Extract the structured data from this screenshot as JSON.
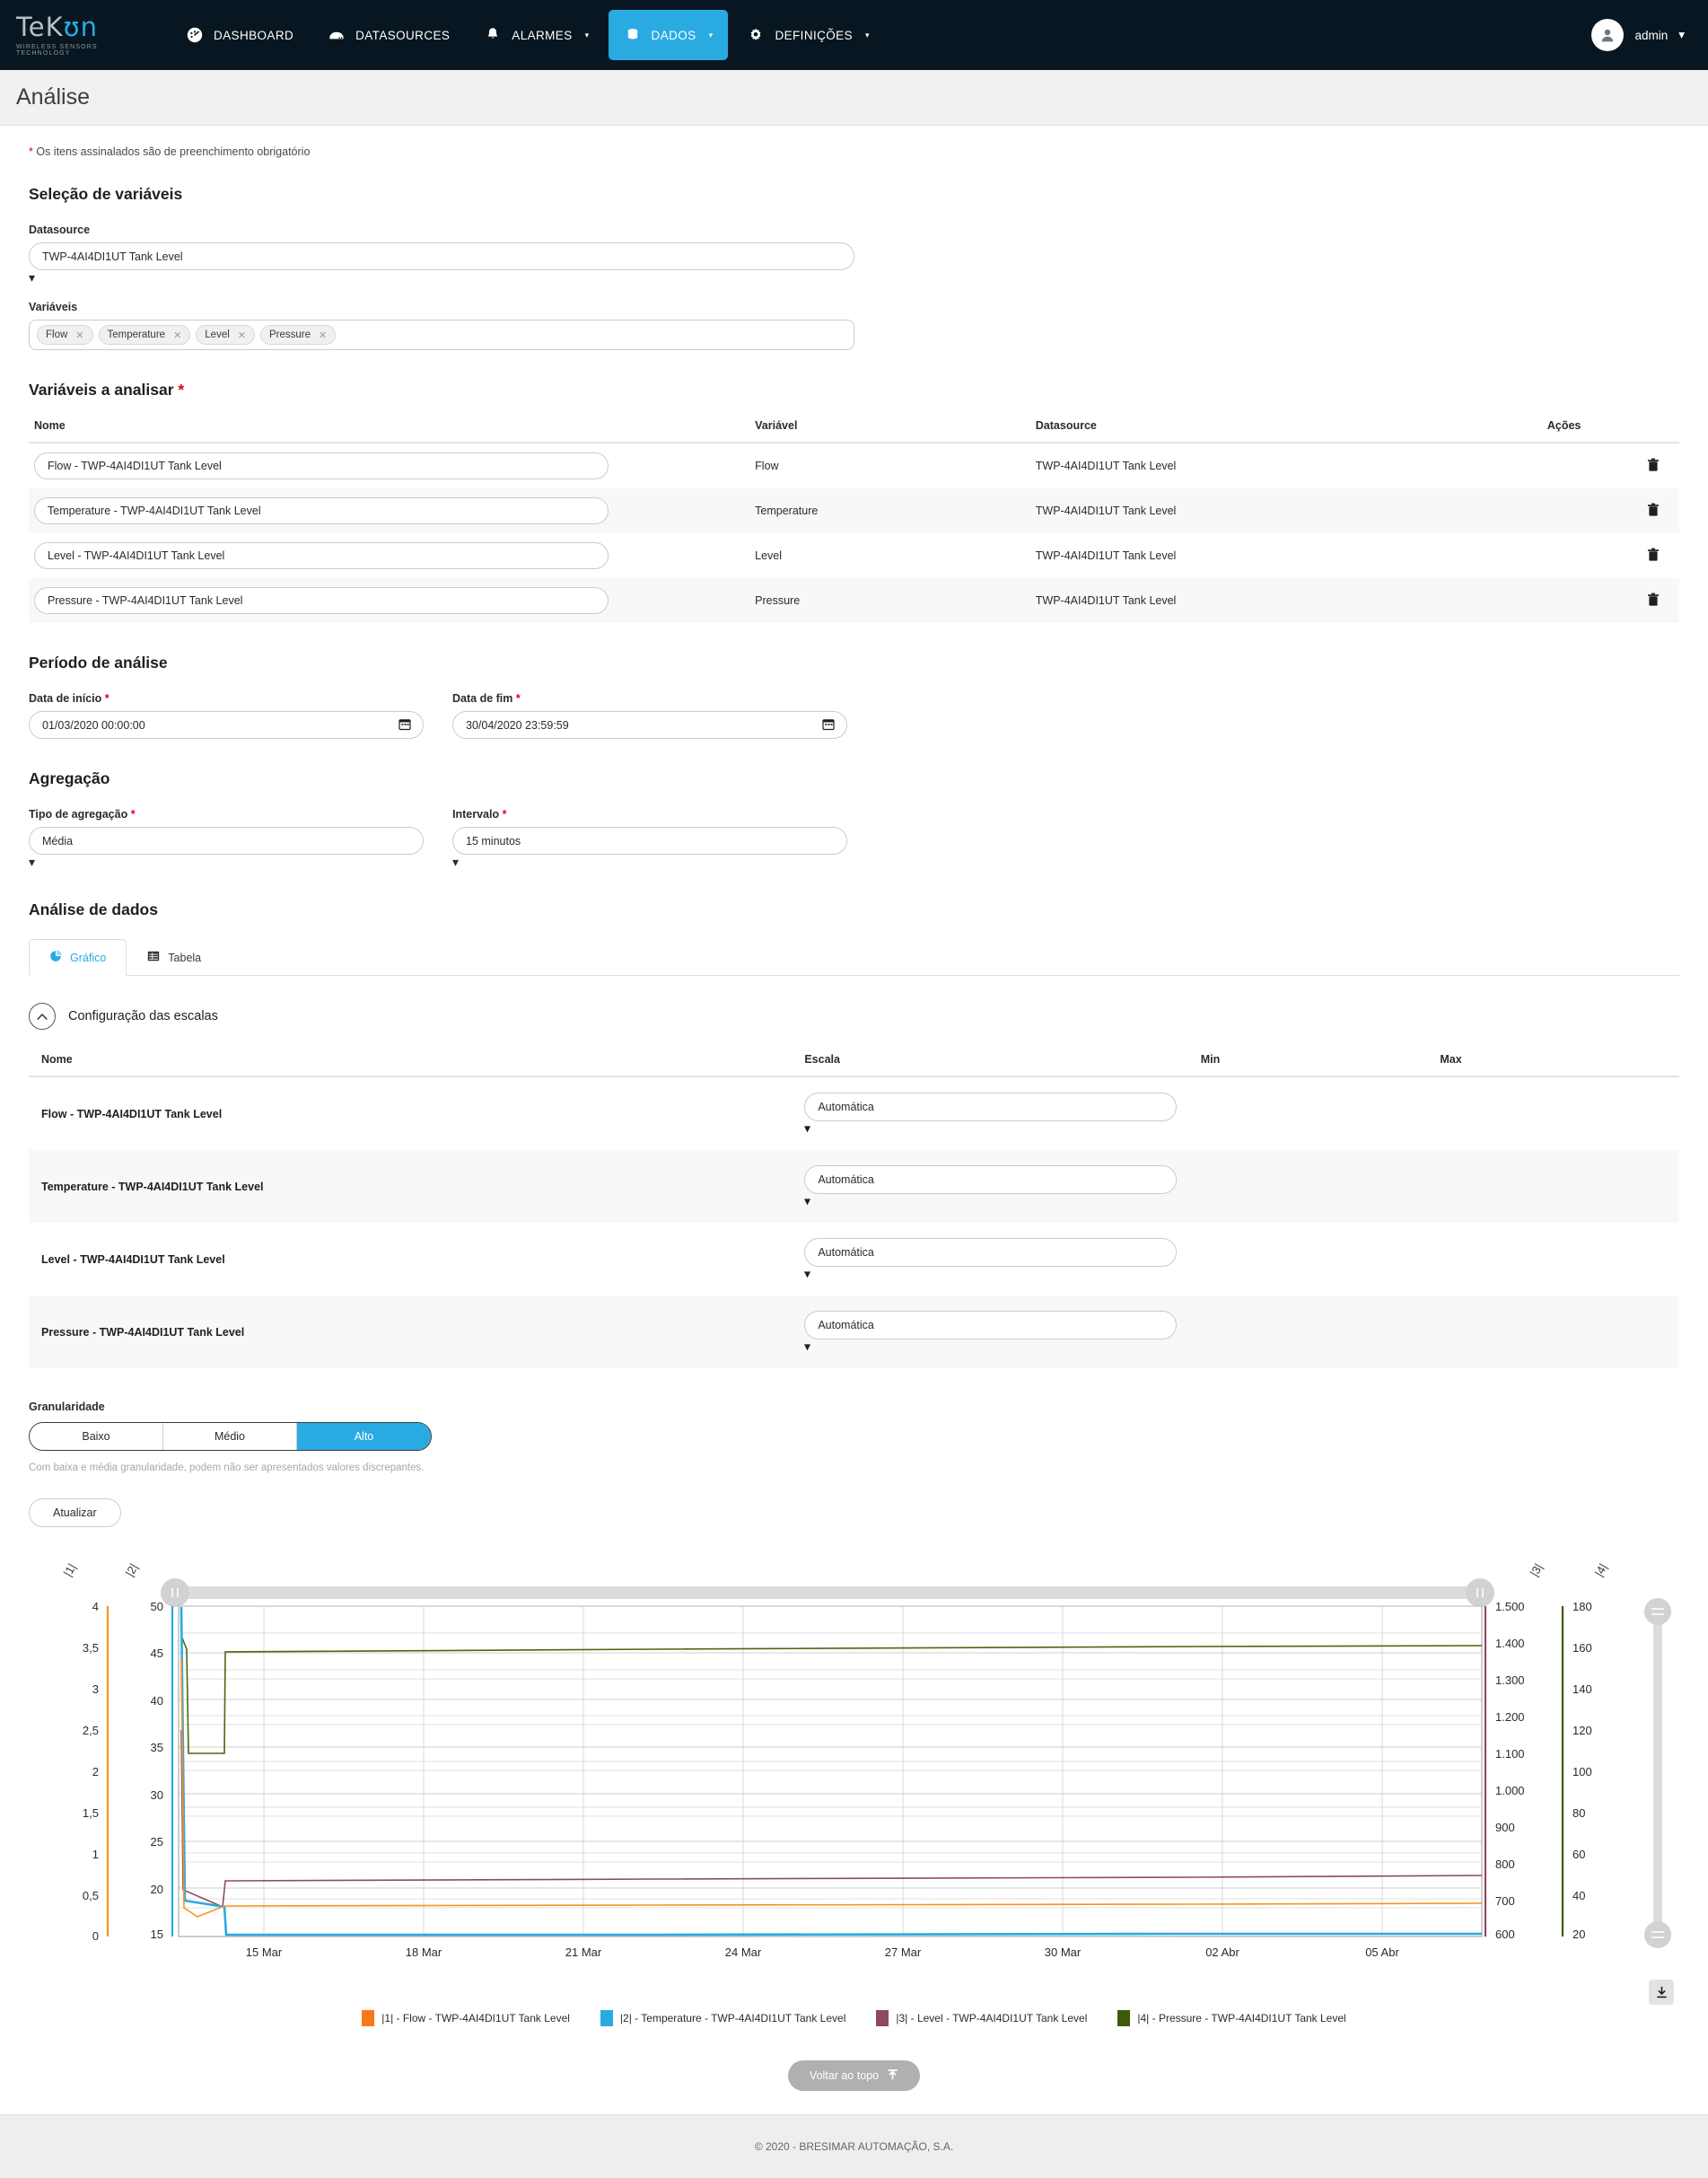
{
  "nav": {
    "brand": {
      "word_left": "TeK",
      "word_blue": "ʊn",
      "tagline": "WIRELESS SENSORS TECHNOLOGY"
    },
    "items": [
      {
        "label": "DASHBOARD",
        "icon": "gauge-icon",
        "active": false,
        "caret": false
      },
      {
        "label": "DATASOURCES",
        "icon": "server-icon",
        "active": false,
        "caret": false
      },
      {
        "label": "ALARMES",
        "icon": "bell-icon",
        "active": false,
        "caret": true
      },
      {
        "label": "DADOS",
        "icon": "database-icon",
        "active": true,
        "caret": true
      },
      {
        "label": "DEFINIÇÕES",
        "icon": "gear-icon",
        "active": false,
        "caret": true
      }
    ],
    "user": {
      "label": "admin",
      "icon": "user-icon",
      "caret": "▾"
    }
  },
  "page": {
    "title": "Análise",
    "required_note_star": "*",
    "required_note": "Os itens assinalados são de preenchimento obrigatório"
  },
  "variable_selection": {
    "heading": "Seleção de variáveis",
    "datasource_label": "Datasource",
    "datasource_value": "TWP-4AI4DI1UT Tank Level",
    "variables_label": "Variáveis",
    "chips": [
      "Flow",
      "Temperature",
      "Level",
      "Pressure"
    ],
    "chip_remove": "✕"
  },
  "variables_table": {
    "heading": "Variáveis a analisar",
    "heading_required": "*",
    "columns": [
      "Nome",
      "Variável",
      "Datasource",
      "Ações"
    ],
    "rows": [
      {
        "nome": "Flow - TWP-4AI4DI1UT Tank Level",
        "variavel": "Flow",
        "datasource": "TWP-4AI4DI1UT Tank Level"
      },
      {
        "nome": "Temperature - TWP-4AI4DI1UT Tank Level",
        "variavel": "Temperature",
        "datasource": "TWP-4AI4DI1UT Tank Level"
      },
      {
        "nome": "Level - TWP-4AI4DI1UT Tank Level",
        "variavel": "Level",
        "datasource": "TWP-4AI4DI1UT Tank Level"
      },
      {
        "nome": "Pressure - TWP-4AI4DI1UT Tank Level",
        "variavel": "Pressure",
        "datasource": "TWP-4AI4DI1UT Tank Level"
      }
    ]
  },
  "period": {
    "heading": "Período de análise",
    "start_label": "Data de início",
    "start_value": "01/03/2020 00:00:00",
    "end_label": "Data de fim",
    "end_value": "30/04/2020 23:59:59",
    "required": "*"
  },
  "aggregation": {
    "heading": "Agregação",
    "type_label": "Tipo de agregação",
    "type_value": "Média",
    "interval_label": "Intervalo",
    "interval_value": "15 minutos",
    "required": "*"
  },
  "analysis": {
    "heading": "Análise de dados",
    "tabs": [
      {
        "label": "Gráfico",
        "icon": "pie-chart-icon",
        "active": true
      },
      {
        "label": "Tabela",
        "icon": "table-icon",
        "active": false
      }
    ]
  },
  "scales": {
    "toggle_icon": "chevron-up-icon",
    "title": "Configuração das escalas",
    "columns": [
      "Nome",
      "Escala",
      "Min",
      "Max"
    ],
    "rows": [
      {
        "nome": "Flow - TWP-4AI4DI1UT Tank Level",
        "escala": "Automática",
        "min": "",
        "max": ""
      },
      {
        "nome": "Temperature - TWP-4AI4DI1UT Tank Level",
        "escala": "Automática",
        "min": "",
        "max": ""
      },
      {
        "nome": "Level - TWP-4AI4DI1UT Tank Level",
        "escala": "Automática",
        "min": "",
        "max": ""
      },
      {
        "nome": "Pressure - TWP-4AI4DI1UT Tank Level",
        "escala": "Automática",
        "min": "",
        "max": ""
      }
    ]
  },
  "granularity": {
    "label": "Granularidade",
    "options": [
      "Baixo",
      "Médio",
      "Alto"
    ],
    "selected": "Alto",
    "hint": "Com baixa e média granularidade, podem não ser apresentados valores discrepantes.",
    "update_button": "Atualizar"
  },
  "chart_data": {
    "type": "line",
    "title": "",
    "xlabel": "",
    "ylabel": "",
    "grid": true,
    "legend_position": "bottom",
    "x_ticks": [
      "15 Mar",
      "18 Mar",
      "21 Mar",
      "24 Mar",
      "27 Mar",
      "30 Mar",
      "02 Abr",
      "05 Abr"
    ],
    "axes": [
      {
        "id": "|1|",
        "name": "Flow",
        "color": "#f7761f",
        "min": 0,
        "max": 4,
        "side": "left",
        "ticks": [
          "4",
          "3,5",
          "3",
          "2,5",
          "2",
          "1,5",
          "1",
          "0,5",
          "0"
        ]
      },
      {
        "id": "|2|",
        "name": "Temperature",
        "color": "#29abe2",
        "min": 15,
        "max": 50,
        "side": "left",
        "ticks": [
          "50",
          "45",
          "40",
          "35",
          "30",
          "25",
          "20",
          "15"
        ]
      },
      {
        "id": "|3|",
        "name": "Level",
        "color": "#8e4a63",
        "min": 600,
        "max": 1500,
        "side": "right",
        "ticks": [
          "1.500",
          "1.400",
          "1.300",
          "1.200",
          "1.100",
          "1.000",
          "900",
          "800",
          "700",
          "600"
        ]
      },
      {
        "id": "|4|",
        "name": "Pressure",
        "color": "#3d5a0a",
        "min": 20,
        "max": 180,
        "side": "right",
        "ticks": [
          "180",
          "160",
          "140",
          "120",
          "100",
          "80",
          "60",
          "40",
          "20"
        ]
      }
    ],
    "series": [
      {
        "name": "|1| - Flow - TWP-4AI4DI1UT Tank Level",
        "axis": "|1|",
        "color": "#f7931e",
        "points": [
          [
            0,
            3.7
          ],
          [
            0.4,
            1.7
          ],
          [
            1.4,
            0.5
          ],
          [
            2.6,
            1.15
          ],
          [
            35,
            1.2
          ],
          [
            100,
            1.25
          ]
        ]
      },
      {
        "name": "|2| - Temperature - TWP-4AI4DI1UT Tank Level",
        "axis": "|2|",
        "color": "#29abe2",
        "points": [
          [
            0,
            50
          ],
          [
            0.5,
            33
          ],
          [
            1.2,
            19
          ],
          [
            2.5,
            18.3
          ],
          [
            3.6,
            15.2
          ],
          [
            100,
            15.3
          ]
        ]
      },
      {
        "name": "|3| - Level - TWP-4AI4DI1UT Tank Level",
        "axis": "|3|",
        "color": "#8e4a63",
        "points": [
          [
            0.5,
            1050
          ],
          [
            1.2,
            700
          ],
          [
            2.7,
            690
          ],
          [
            3.0,
            790
          ],
          [
            35,
            795
          ],
          [
            100,
            800
          ]
        ]
      },
      {
        "name": "|4| - Pressure - TWP-4AI4DI1UT Tank Level",
        "axis": "|4|",
        "color": "#4d6611",
        "points": [
          [
            0.6,
            148
          ],
          [
            1.0,
            136
          ],
          [
            3.0,
            137
          ],
          [
            3.3,
            175
          ],
          [
            40,
            177
          ],
          [
            100,
            178
          ]
        ]
      }
    ],
    "legend": [
      {
        "label": "|1| - Flow - TWP-4AI4DI1UT Tank Level",
        "color": "#f7791a"
      },
      {
        "label": "|2| - Temperature - TWP-4AI4DI1UT Tank Level",
        "color": "#29abe2"
      },
      {
        "label": "|3| - Level - TWP-4AI4DI1UT Tank Level",
        "color": "#8e4a63"
      },
      {
        "label": "|4| - Pressure - TWP-4AI4DI1UT Tank Level",
        "color": "#3d5a0a"
      }
    ],
    "download_icon": "download-icon"
  },
  "bottom": {
    "to_top": "Voltar ao topo",
    "to_top_icon": "arrow-up-icon",
    "copyright": "© 2020 - BRESIMAR AUTOMAÇÃO, S.A."
  }
}
